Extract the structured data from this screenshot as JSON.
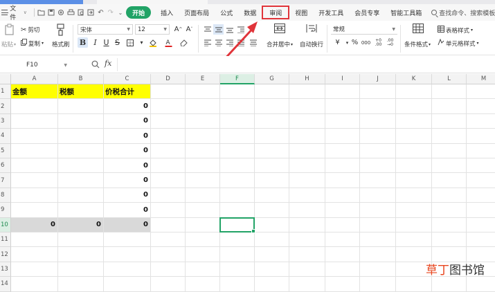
{
  "menubar": {
    "file_label": "文件",
    "tabs": [
      "开始",
      "插入",
      "页面布局",
      "公式",
      "数据",
      "审阅",
      "视图",
      "开发工具",
      "会员专享",
      "智能工具箱"
    ],
    "search_label": "查找命令、搜索模板"
  },
  "ribbon": {
    "paste_label": "粘贴",
    "cut_label": "剪切",
    "copy_label": "复制",
    "format_painter_label": "格式刷",
    "font_name": "宋体",
    "font_size": "12",
    "merge_center_label": "合并居中",
    "wrap_text_label": "自动换行",
    "number_format": "常规",
    "conditional_format_label": "条件格式",
    "table_style_label": "表格样式",
    "cell_style_label": "单元格样式"
  },
  "formulabar": {
    "cell_ref": "F10",
    "fx_label": "fx",
    "formula": ""
  },
  "sheet": {
    "columns": [
      "A",
      "B",
      "C",
      "D",
      "E",
      "F",
      "G",
      "H",
      "I",
      "J",
      "K",
      "L",
      "M"
    ],
    "row_numbers": [
      "1",
      "2",
      "3",
      "4",
      "5",
      "6",
      "7",
      "8",
      "9",
      "10",
      "11",
      "12",
      "13",
      "14"
    ],
    "header_row": [
      "金额",
      "税额",
      "价税合计"
    ],
    "c_values": [
      "0",
      "0",
      "0",
      "0",
      "0",
      "0",
      "0",
      "0"
    ],
    "row10": [
      "0",
      "0",
      "0"
    ],
    "selected_column": "F",
    "selected_row": "10"
  },
  "watermark": {
    "part1": "草丁",
    "part2": "图书馆"
  },
  "colors": {
    "accent_green": "#21a366",
    "highlight_yellow": "#ffff00",
    "annotation_red": "#e0343a"
  }
}
